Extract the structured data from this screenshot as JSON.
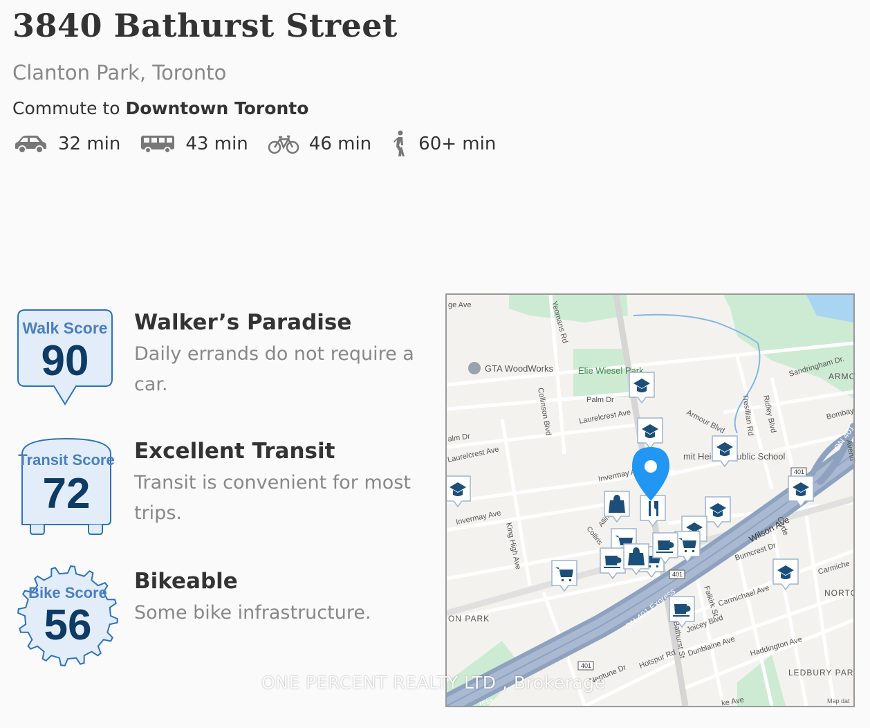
{
  "listing": {
    "address": "3840 Bathurst Street",
    "neighbourhood": "Clanton Park, Toronto",
    "commute_prefix": "Commute to",
    "commute_destination": "Downtown Toronto"
  },
  "commute_modes": [
    {
      "mode": "car",
      "icon": "car-icon",
      "time": "32 min"
    },
    {
      "mode": "transit",
      "icon": "bus-icon",
      "time": "43 min"
    },
    {
      "mode": "bike",
      "icon": "bicycle-icon",
      "time": "46 min"
    },
    {
      "mode": "walk",
      "icon": "walking-person-icon",
      "time": "60+ min"
    }
  ],
  "scores": {
    "walk": {
      "label": "Walk Score",
      "value": "90",
      "heading": "Walker’s Paradise",
      "description": "Daily errands do not require a car."
    },
    "transit": {
      "label": "Transit Score",
      "value": "72",
      "heading": "Excellent Transit",
      "description": "Transit is convenient for most trips."
    },
    "bike": {
      "label": "Bike Score",
      "value": "56",
      "heading": "Bikeable",
      "description": "Some bike infrastructure."
    }
  },
  "map": {
    "labels": {
      "gta_woodworks": "GTA WoodWorks",
      "park": "Elie Wiesel Park",
      "school": "mit Heights Public School",
      "yeomans": "Yeomans Rd",
      "collinson": "Collinson Blvd",
      "palm_dr": "Palm Dr",
      "palm_dr_left": "alm Dr",
      "laurelcrest1": "Laurelcrest Ave",
      "laurelcrest2": "Laurelcrest Ave",
      "invermay1": "Invermay Ave",
      "invermay2": "Invermay A",
      "king_high": "King High Ave",
      "armour": "Armour Blvd",
      "tresillian": "Tresillian Rd",
      "ridley": "Ridley Blvd",
      "sandringham": "Sandringham Dr.",
      "armour_heights": "ARMO HEIGH",
      "bombay": "Bombay A",
      "on401_top": "ON 401",
      "avenue": "Avenu",
      "wilson": "Wilson Ave",
      "clyde": "Clyde",
      "burncrest": "Burncrest Dr",
      "carmichael_right": "Carmiche",
      "north": "NORTO",
      "carmichael": "Carmichael Ave",
      "falkirk": "Falkirk St",
      "on401_express": "ON 401 Express",
      "bathurst": "Bathurst St",
      "joicey": "Joicey Blvd",
      "dunblaine": "Dunblaine Ave",
      "haddington": "Haddington Ave",
      "hotspur": "Hotspur Rd",
      "neptune": "Neptune Dr",
      "express_bottom": "ress",
      "ledbury": "LEDBURY PAR",
      "clanton_park": "ON PARK",
      "ge_ave": "ge Ave",
      "ke_ave": "ke Ave",
      "alling": "Alling",
      "collins": "Collins",
      "marker401a": "401",
      "marker401b": "401",
      "marker401c": "401",
      "map_data": "Map dat"
    }
  },
  "watermark": "ONE PERCENT REALTY LTD , Brokerage",
  "colors": {
    "score_blue": "#1a5fa8",
    "score_light": "#e3edf9",
    "map_pin": "#2196f3",
    "poi_blue": "#1b4f7a"
  }
}
